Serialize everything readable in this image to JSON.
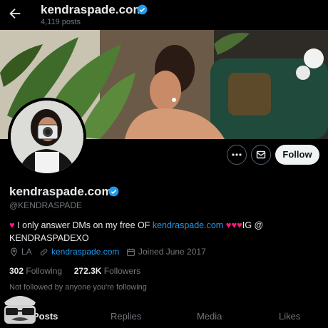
{
  "topbar": {
    "title": "kendraspade.com",
    "posts_count": "4,119 posts"
  },
  "profile": {
    "display_name": "kendraspade.com",
    "handle": "@KENDRASPADE",
    "verified_color": "#1d9bf0"
  },
  "actions": {
    "follow_label": "Follow"
  },
  "bio": {
    "part1": "I only answer DMs on my free OF",
    "link": "kendraspade.com",
    "part2": "IG @",
    "part3": "KENDRASPADEXO"
  },
  "meta": {
    "location": "LA",
    "website": "kendraspade.com",
    "joined": "Joined June 2017"
  },
  "stats": {
    "following_count": "302",
    "following_label": "Following",
    "followers_count": "272.3K",
    "followers_label": "Followers"
  },
  "not_followed": "Not followed by anyone you're following",
  "tabs": [
    {
      "label": "Posts"
    },
    {
      "label": "Replies"
    },
    {
      "label": "Media"
    },
    {
      "label": "Likes"
    }
  ],
  "colors": {
    "accent": "#1d9bf0",
    "heart": "#f91880",
    "background": "#000000"
  }
}
